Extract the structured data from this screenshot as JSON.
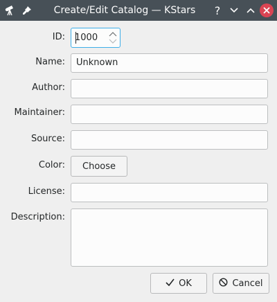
{
  "window": {
    "title": "Create/Edit Catalog — KStars",
    "app_icon": "kstars-telescope-icon",
    "controls": [
      "pin-icon",
      "help-icon",
      "minimize-icon",
      "maximize-icon",
      "close-icon"
    ]
  },
  "form": {
    "id_label": "ID:",
    "id_value": "1000",
    "name_label": "Name:",
    "name_value": "Unknown",
    "author_label": "Author:",
    "author_value": "",
    "maintainer_label": "Maintainer:",
    "maintainer_value": "",
    "source_label": "Source:",
    "source_value": "",
    "color_label": "Color:",
    "color_button": "Choose",
    "license_label": "License:",
    "license_value": "",
    "description_label": "Description:",
    "description_value": ""
  },
  "buttons": {
    "ok": "OK",
    "cancel": "Cancel"
  },
  "colors": {
    "titlebar": "#475057",
    "close": "#da4453",
    "focus": "#3daee9"
  }
}
